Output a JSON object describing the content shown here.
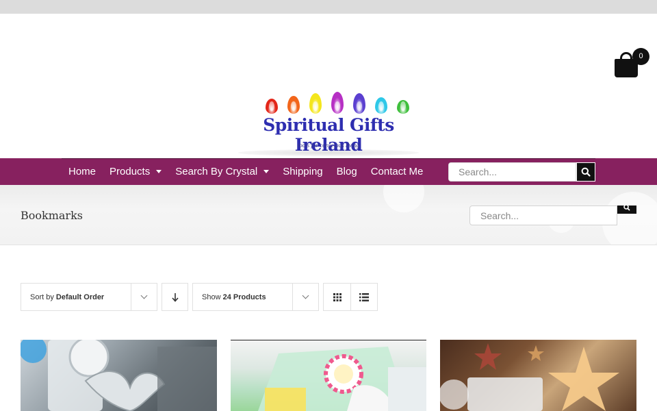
{
  "header": {
    "logo_text": "Spiritual Gifts Ireland",
    "logo_tagline": "tools for conscious living",
    "logo_flame_colors": [
      "#e32619",
      "#f2651a",
      "#f4e61c",
      "#b62fc4",
      "#5b3fd0",
      "#2ec8e8",
      "#3fbf3c"
    ],
    "cart_count": "0"
  },
  "nav": {
    "items": [
      {
        "label": "Home",
        "has_dropdown": false
      },
      {
        "label": "Products",
        "has_dropdown": true
      },
      {
        "label": "Search By Crystal",
        "has_dropdown": true
      },
      {
        "label": "Shipping",
        "has_dropdown": false
      },
      {
        "label": "Blog",
        "has_dropdown": false
      },
      {
        "label": "Contact Me",
        "has_dropdown": false
      }
    ],
    "search_placeholder": "Search...",
    "bar_color": "#87215f"
  },
  "page": {
    "title": "Bookmarks",
    "search_placeholder": "Search..."
  },
  "shop": {
    "sort_prefix": "Sort by",
    "sort_value": "Default Order",
    "show_prefix": "Show",
    "show_value": "24 Products"
  },
  "products": [
    {
      "image_icon": "butterfly-bookmark-image"
    },
    {
      "image_icon": "butterfly-gift-box-image"
    },
    {
      "image_icon": "star-bookmark-image"
    }
  ]
}
